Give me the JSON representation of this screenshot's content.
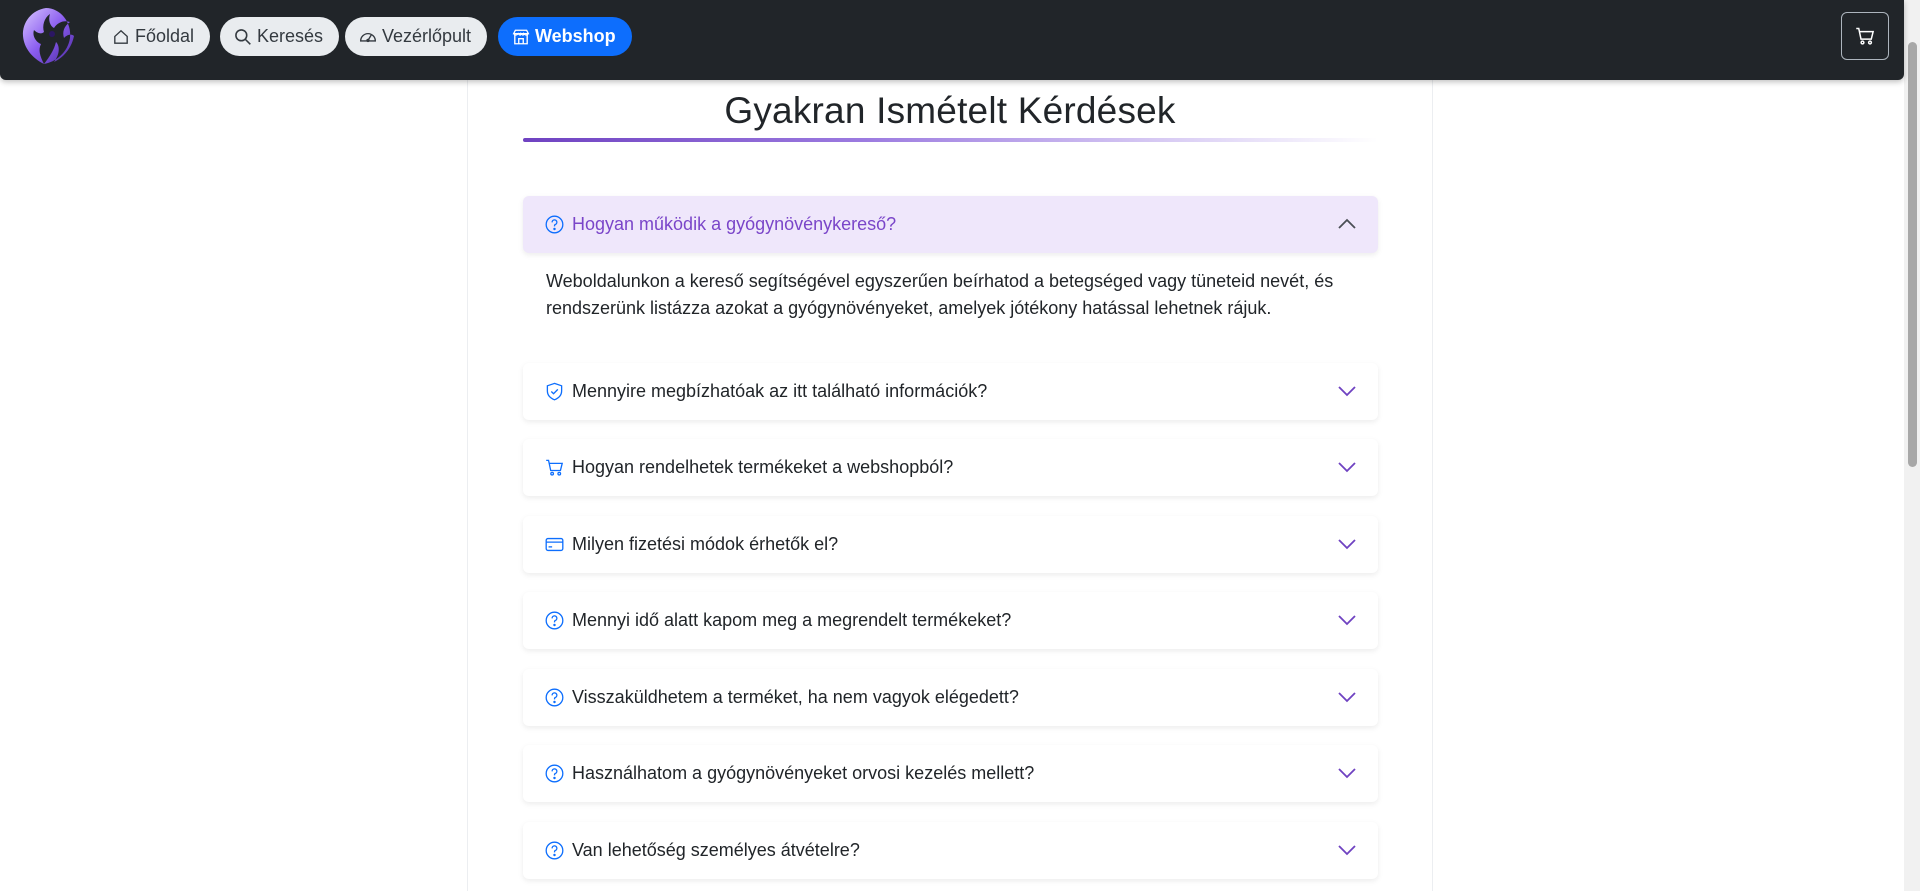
{
  "navbar": {
    "items": [
      {
        "label": "Főoldal",
        "icon": "home-icon"
      },
      {
        "label": "Keresés",
        "icon": "search-icon"
      },
      {
        "label": "Vezérlőpult",
        "icon": "dashboard-icon"
      },
      {
        "label": "Webshop",
        "icon": "shop-icon",
        "active": true
      }
    ],
    "cart_icon": "cart-icon"
  },
  "page": {
    "title": "Gyakran Ismételt Kérdések"
  },
  "faq": {
    "items": [
      {
        "question": "Hogyan működik a gyógynövénykereső?",
        "icon": "question-circle-icon",
        "open": true,
        "answer": "Weboldalunkon a kereső segítségével egyszerűen beírhatod a betegséged vagy tüneteid nevét, és rendszerünk listázza azokat a gyógynövényeket, amelyek jótékony hatással lehetnek rájuk."
      },
      {
        "question": "Mennyire megbízhatóak az itt található információk?",
        "icon": "shield-check-icon",
        "open": false
      },
      {
        "question": "Hogyan rendelhetek termékeket a webshopból?",
        "icon": "cart-icon",
        "open": false
      },
      {
        "question": "Milyen fizetési módok érhetők el?",
        "icon": "credit-card-icon",
        "open": false
      },
      {
        "question": "Mennyi idő alatt kapom meg a megrendelt termékeket?",
        "icon": "question-circle-icon",
        "open": false
      },
      {
        "question": "Visszaküldhetem a terméket, ha nem vagyok elégedett?",
        "icon": "question-circle-icon",
        "open": false
      },
      {
        "question": "Használhatom a gyógynövényeket orvosi kezelés mellett?",
        "icon": "question-circle-icon",
        "open": false
      },
      {
        "question": "Van lehetőség személyes átvételre?",
        "icon": "question-circle-icon",
        "open": false
      }
    ]
  },
  "colors": {
    "navbar_bg": "#212529",
    "primary": "#0d6efd",
    "accent_purple": "#6f42c1",
    "open_item_bg": "#efe7fb"
  }
}
